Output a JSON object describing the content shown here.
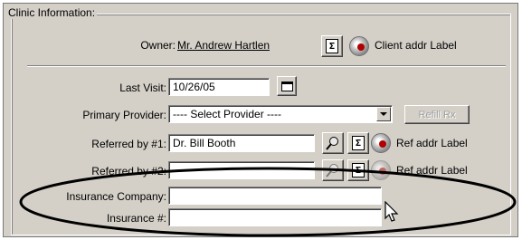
{
  "group_title": "Clinic Information:",
  "owner": {
    "label": "Owner:",
    "name": "Mr. Andrew Hartlen",
    "addr_label": "Client addr Label"
  },
  "last_visit": {
    "label": "Last Visit:",
    "value": "10/26/05"
  },
  "primary_provider": {
    "label": "Primary Provider:",
    "value": "---- Select Provider ----",
    "refill_label": "Refill Rx"
  },
  "referred1": {
    "label": "Referred by #1:",
    "value": "Dr.  Bill Booth",
    "addr_label": "Ref addr Label"
  },
  "referred2": {
    "label": "Referred by #2:",
    "value": "",
    "addr_label": "Ref addr Label"
  },
  "insurance_company": {
    "label": "Insurance Company:",
    "value": ""
  },
  "insurance_number": {
    "label": "Insurance #:",
    "value": ""
  },
  "icons": [
    "label-doc-icon",
    "globe-icon",
    "calendar-icon",
    "search-icon",
    "dropdown-arrow-icon",
    "cursor-icon"
  ],
  "colors": {
    "window_bg": "#d4d0c8",
    "globe_dot": "#b00000",
    "highlight_oval": "#000000"
  }
}
